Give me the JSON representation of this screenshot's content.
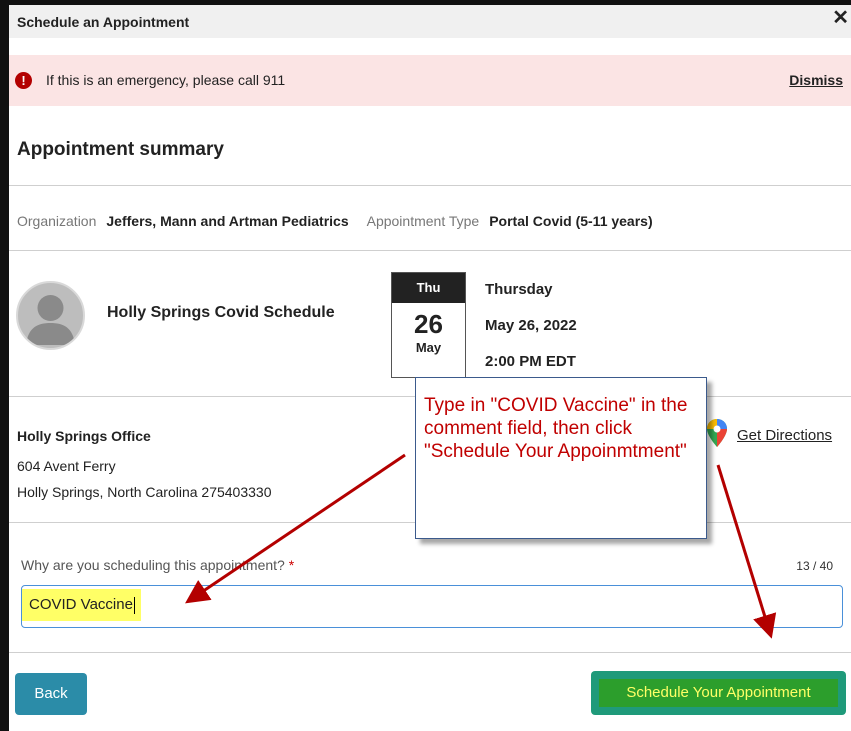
{
  "dialog": {
    "title": "Schedule an Appointment",
    "close_icon": "close-icon"
  },
  "alert": {
    "icon": "exclamation-circle-icon",
    "text": "If this is an emergency, please call 911",
    "dismiss_label": "Dismiss"
  },
  "summary": {
    "heading": "Appointment summary",
    "organization_label": "Organization",
    "organization_value": "Jeffers, Mann and Artman Pediatrics",
    "type_label": "Appointment Type",
    "type_value": "Portal Covid (5-11 years)"
  },
  "provider": {
    "avatar_icon": "user-avatar-icon",
    "name": "Holly Springs Covid Schedule"
  },
  "calendar": {
    "day_abbr": "Thu",
    "day_num": "26",
    "month_abbr": "May"
  },
  "datetime": {
    "weekday": "Thursday",
    "date": "May 26, 2022",
    "time": "2:00 PM EDT"
  },
  "location": {
    "name": "Holly Springs Office",
    "address_line1": "604 Avent Ferry",
    "address_line2": "Holly Springs, North Carolina 275403330",
    "map_icon": "map-pin-icon",
    "directions_label": "Get Directions"
  },
  "reason": {
    "question": "Why are you scheduling this appointment?",
    "required_marker": "*",
    "counter": "13 / 40",
    "value": "COVID Vaccine"
  },
  "footer": {
    "back_label": "Back",
    "schedule_label": "Schedule Your Appointment"
  },
  "annotation": {
    "callout_text": "Type in \"COVID Vaccine\" in the comment field, then click \"Schedule Your Appoinmtment\""
  },
  "colors": {
    "alert_bg": "#fbe4e4",
    "primary_button": "#2b8ca8",
    "schedule_button": "#1f9a7a",
    "highlight": "#ffff66",
    "annotation_red": "#c00000"
  }
}
